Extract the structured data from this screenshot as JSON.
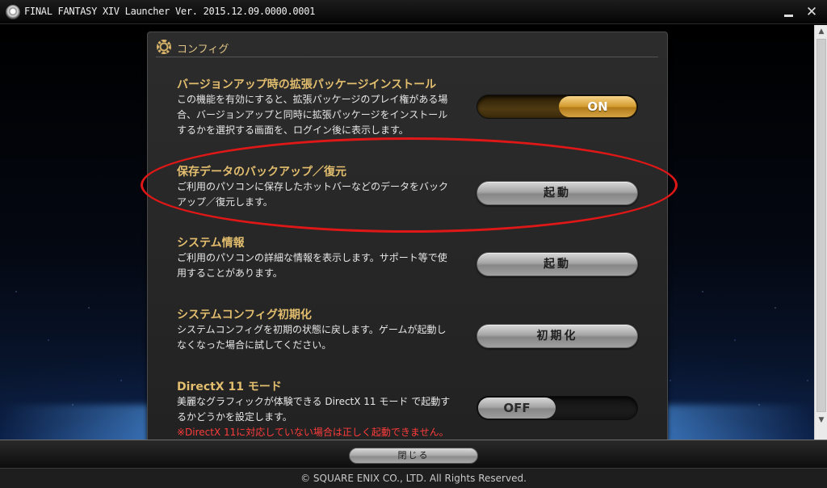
{
  "window": {
    "title": "FINAL FANTASY XIV Launcher Ver. 2015.12.09.0000.0001",
    "minimize_label": "",
    "close_label": "✕"
  },
  "panel": {
    "title": "コンフィグ"
  },
  "items": [
    {
      "title": "バージョンアップ時の拡張パッケージインストール",
      "desc": "この機能を有効にすると、拡張パッケージのプレイ権がある場合、バージョンアップと同時に拡張パッケージをインストールするかを選択する画面を、ログイン後に表示します。",
      "control_type": "toggle",
      "control_label": "ON"
    },
    {
      "title": "保存データのバックアップ／復元",
      "desc": "ご利用のパソコンに保存したホットバーなどのデータをバックアップ／復元します。",
      "control_type": "button",
      "control_label": "起動"
    },
    {
      "title": "システム情報",
      "desc": "ご利用のパソコンの詳細な情報を表示します。サポート等で使用することがあります。",
      "control_type": "button",
      "control_label": "起動"
    },
    {
      "title": "システムコンフィグ初期化",
      "desc": "システムコンフィグを初期の状態に戻します。ゲームが起動しなくなった場合に試してください。",
      "control_type": "button",
      "control_label": "初期化"
    },
    {
      "title": "DirectX 11 モード",
      "desc": "美麗なグラフィックが体験できる DirectX 11 モード で起動するかどうかを設定します。",
      "warning": "※DirectX 11に対応していない場合は正しく起動できません。",
      "control_type": "toggle",
      "control_label": "OFF"
    }
  ],
  "bottom": {
    "close_button": "閉じる",
    "copyright": "© SQUARE ENIX CO., LTD. All Rights Reserved."
  },
  "colors": {
    "accent_gold": "#e2be6e",
    "annotation_red": "#e01717",
    "warning_red": "#ff3b3b"
  }
}
